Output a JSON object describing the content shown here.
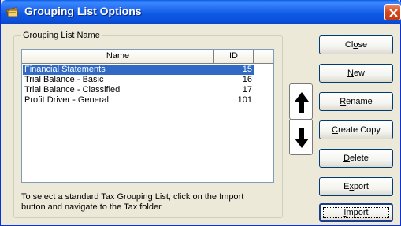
{
  "window": {
    "title": "Grouping List Options",
    "accent": "#0a58e4"
  },
  "group": {
    "label": "Grouping List Name"
  },
  "list": {
    "columns": [
      "Name",
      "ID"
    ],
    "rows": [
      {
        "name": "Financial Statements",
        "id": "15",
        "selected": true
      },
      {
        "name": "Trial Balance - Basic",
        "id": "16",
        "selected": false
      },
      {
        "name": "Trial Balance - Classified",
        "id": "17",
        "selected": false
      },
      {
        "name": "Profit Driver  - General",
        "id": "101",
        "selected": false
      }
    ]
  },
  "hint": "To select a standard Tax Grouping List, click on the Import button and navigate to the Tax folder.",
  "buttons": {
    "close": {
      "pre": "Cl",
      "key": "o",
      "post": "se"
    },
    "new": {
      "pre": "",
      "key": "N",
      "post": "ew"
    },
    "rename": {
      "pre": "",
      "key": "R",
      "post": "ename"
    },
    "create_copy": {
      "pre": "",
      "key": "C",
      "post": "reate Copy"
    },
    "delete": {
      "pre": "",
      "key": "D",
      "post": "elete"
    },
    "export": {
      "pre": "E",
      "key": "x",
      "post": "port"
    },
    "import": {
      "pre": "",
      "key": "I",
      "post": "mport"
    }
  },
  "icons": {
    "app": "books-icon",
    "move_up": "arrow-up-icon",
    "move_down": "arrow-down-icon",
    "close": "close-icon"
  }
}
